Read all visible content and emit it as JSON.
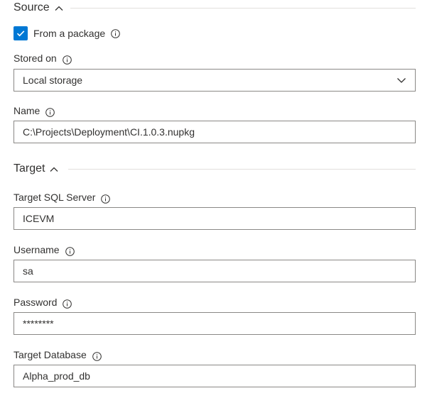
{
  "source_section": {
    "title": "Source",
    "from_package": {
      "label": "From a package",
      "checked": true
    },
    "stored_on": {
      "label": "Stored on",
      "value": "Local storage"
    },
    "name": {
      "label": "Name",
      "value": "C:\\Projects\\Deployment\\CI.1.0.3.nupkg"
    }
  },
  "target_section": {
    "title": "Target",
    "sql_server": {
      "label": "Target SQL Server",
      "value": "ICEVM"
    },
    "username": {
      "label": "Username",
      "value": "sa"
    },
    "password": {
      "label": "Password",
      "value": "********"
    },
    "database": {
      "label": "Target Database",
      "value": "Alpha_prod_db"
    }
  },
  "icons": {
    "collapse": "chevron-up-icon",
    "dropdown": "chevron-down-icon",
    "info": "info-icon",
    "check": "checkmark-icon"
  },
  "colors": {
    "accent": "#0078d4",
    "border": "#8a8886",
    "text": "#323130",
    "divider": "#e1dfdd"
  }
}
